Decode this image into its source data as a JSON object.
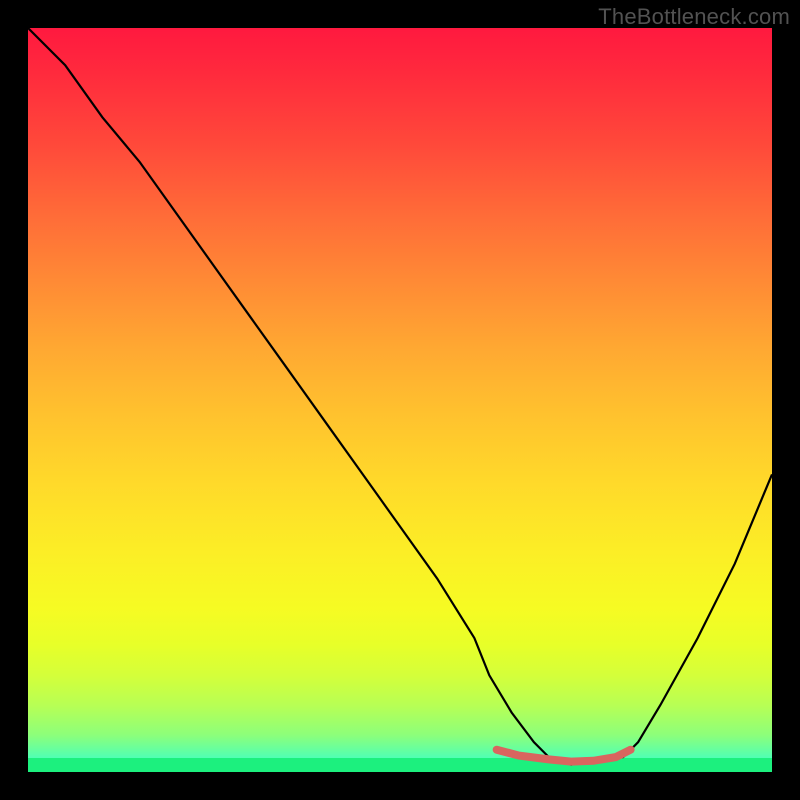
{
  "watermark": "TheBottleneck.com",
  "colors": {
    "background_frame": "#000000",
    "curve": "#000000",
    "highlight_segment": "#d9655f",
    "gradient_top": "#ff193f",
    "gradient_bottom": "#1affe6",
    "green_band": "#1cf07e"
  },
  "chart_data": {
    "type": "line",
    "title": "",
    "xlabel": "",
    "ylabel": "",
    "xlim": [
      0,
      100
    ],
    "ylim": [
      0,
      100
    ],
    "grid": false,
    "description": "V-shaped bottleneck curve over a red-to-green vertical heat gradient; minimum (green zone) near x≈70–80.",
    "series": [
      {
        "name": "bottleneck_curve",
        "x": [
          0,
          5,
          10,
          15,
          20,
          25,
          30,
          35,
          40,
          45,
          50,
          55,
          60,
          62,
          65,
          68,
          70,
          73,
          76,
          80,
          82,
          85,
          90,
          95,
          100
        ],
        "y": [
          100,
          95,
          88,
          82,
          75,
          68,
          61,
          54,
          47,
          40,
          33,
          26,
          18,
          13,
          8,
          4,
          2,
          1,
          1.5,
          2,
          4,
          9,
          18,
          28,
          40
        ]
      },
      {
        "name": "highlight_segment",
        "x": [
          63,
          66,
          70,
          73,
          76,
          79,
          81
        ],
        "y": [
          3,
          2.2,
          1.7,
          1.4,
          1.5,
          2,
          3
        ]
      }
    ]
  }
}
